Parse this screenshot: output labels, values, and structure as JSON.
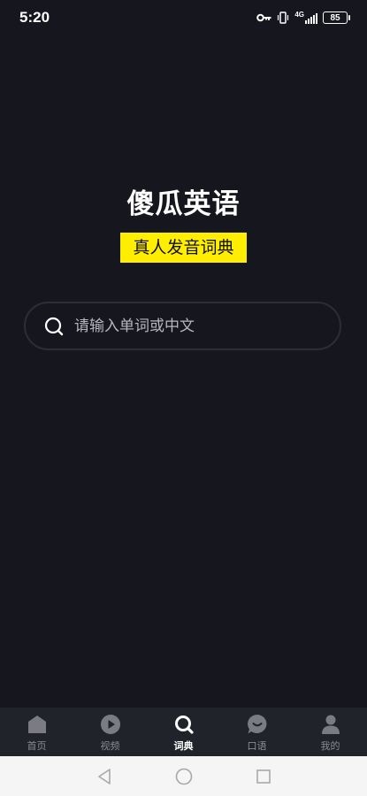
{
  "status": {
    "time": "5:20",
    "network": "4G",
    "battery": "85",
    "icons": [
      "vpn-key-icon",
      "vibrate-icon",
      "signal-icon",
      "battery-icon"
    ]
  },
  "app": {
    "title": "傻瓜英语",
    "subtitle": "真人发音词典",
    "accent": "#ffee00"
  },
  "search": {
    "placeholder": "请输入单词或中文",
    "value": ""
  },
  "tabs": [
    {
      "label": "首页",
      "icon": "home-icon",
      "active": false
    },
    {
      "label": "视频",
      "icon": "video-icon",
      "active": false
    },
    {
      "label": "词典",
      "icon": "search-icon",
      "active": true
    },
    {
      "label": "口语",
      "icon": "chat-icon",
      "active": false
    },
    {
      "label": "我的",
      "icon": "user-icon",
      "active": false
    }
  ],
  "system_nav": [
    "back-icon",
    "home-circle-icon",
    "recents-icon"
  ]
}
